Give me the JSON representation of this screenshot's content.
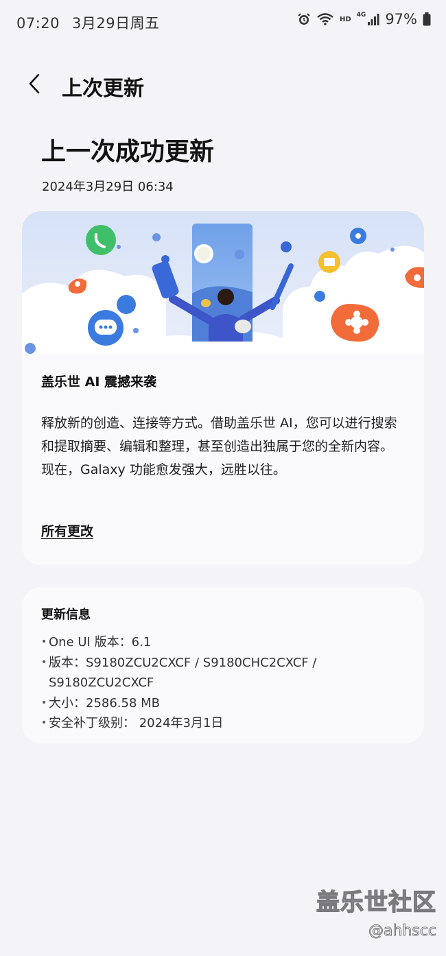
{
  "status_bar": {
    "time": "07:20",
    "date": "3月29日周五",
    "battery": "97%",
    "hd_label": "HD",
    "network_label": "4G",
    "icons": [
      "alarm-icon",
      "wifi-icon",
      "signal-icon",
      "battery-icon"
    ]
  },
  "header": {
    "title": "上次更新",
    "back_icon": "chevron-left-icon"
  },
  "page": {
    "title": "上一次成功更新",
    "update_time": "2024年3月29日 06:34"
  },
  "feature_card": {
    "title": "盖乐世 AI 震撼来袭",
    "description": "释放新的创造、连接等方式。借助盖乐世 AI，您可以进行搜索和提取摘要、编辑和整理，甚至创造出独属于您的全新内容。现在，Galaxy 功能愈发强大，远胜以往。",
    "all_changes": "所有更改"
  },
  "info_card": {
    "title": "更新信息",
    "items": [
      "One UI 版本：6.1",
      "版本：S9180ZCU2CXCF / S9180CHC2CXCF /",
      "安全补丁级别： 2024年3月1日"
    ],
    "version_cont": "S9180ZCU2CXCF",
    "size": "大小：2586.58 MB"
  },
  "watermark": {
    "main": "盖乐世社区",
    "sub": "@ahhscc"
  },
  "colors": {
    "background": "#f4f4f8",
    "card": "#fafafd",
    "accent_blue": "#3d6fe0",
    "accent_orange": "#f26b3a"
  }
}
